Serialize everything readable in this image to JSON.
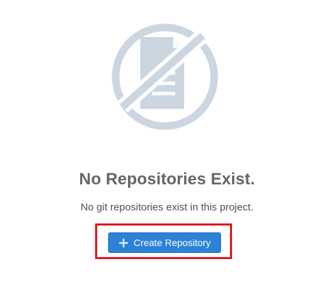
{
  "empty_state": {
    "illustration_icon": "no-repository-document-icon",
    "title": "No Repositories Exist.",
    "description": "No git repositories exist in this project.",
    "create_button_label": "Create Repository",
    "create_button_icon": "plus-icon"
  },
  "colors": {
    "illustration": "#ccd6e0",
    "title": "#666666",
    "description": "#4f4f4f",
    "button_background": "#2b82d6",
    "button_text": "#ffffff",
    "highlight": "#e8141b"
  }
}
